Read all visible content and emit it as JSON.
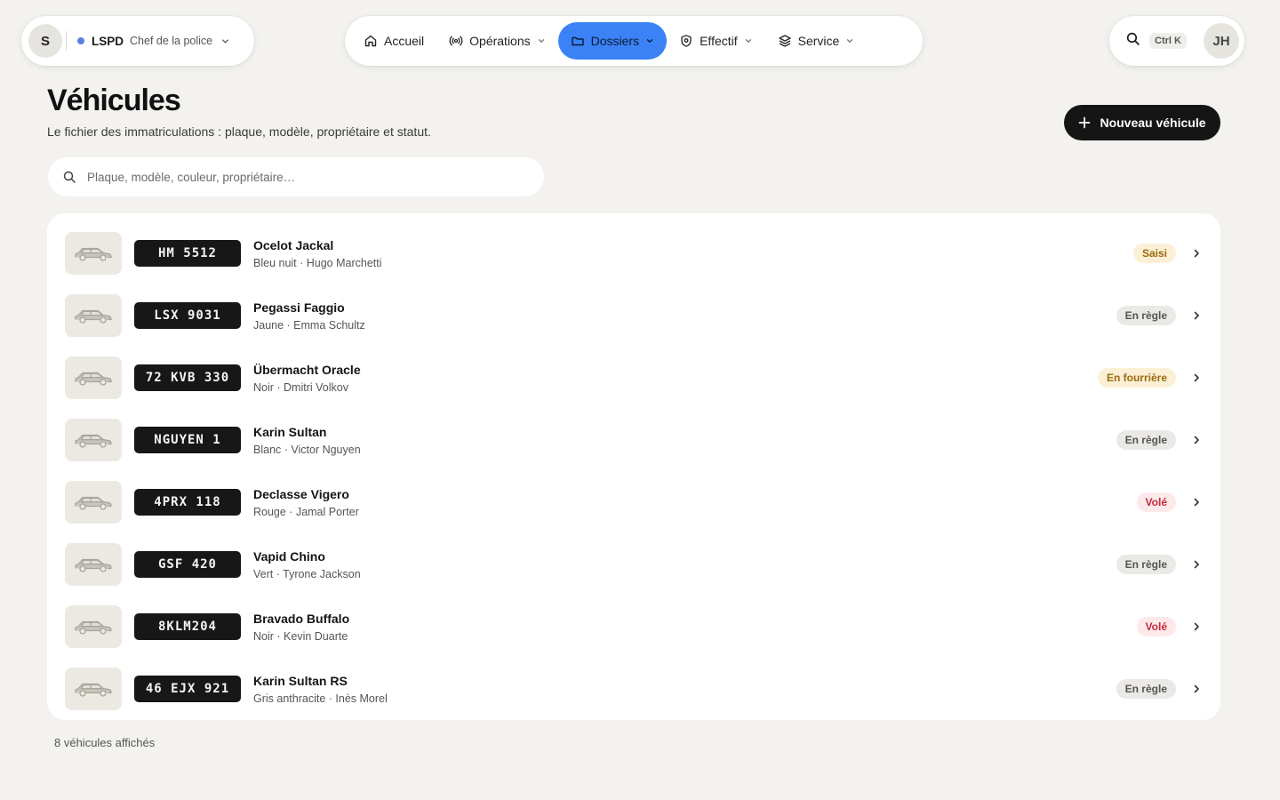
{
  "topbar": {
    "org": {
      "avatar_initial": "S",
      "name": "LSPD",
      "role": "Chef de la police",
      "status_color": "#5b7fe0"
    },
    "nav": [
      {
        "label": "Accueil",
        "icon": "home-icon",
        "has_dropdown": false,
        "active": false
      },
      {
        "label": "Opérations",
        "icon": "broadcast-icon",
        "has_dropdown": true,
        "active": false
      },
      {
        "label": "Dossiers",
        "icon": "folder-icon",
        "has_dropdown": true,
        "active": true
      },
      {
        "label": "Effectif",
        "icon": "shield-icon",
        "has_dropdown": true,
        "active": false
      },
      {
        "label": "Service",
        "icon": "layers-icon",
        "has_dropdown": true,
        "active": false
      }
    ],
    "shortcut": "Ctrl K",
    "user_initials": "JH",
    "accent": "#3b82f6"
  },
  "header": {
    "title": "Véhicules",
    "subtitle": "Le fichier des immatriculations : plaque, modèle, propriétaire et statut.",
    "new_button_label": "Nouveau véhicule"
  },
  "search": {
    "placeholder": "Plaque, modèle, couleur, propriétaire…",
    "value": ""
  },
  "vehicles": [
    {
      "plate": "HM 5512",
      "model": "Ocelot Jackal",
      "meta": "Bleu nuit · Hugo Marchetti",
      "status": "Saisi",
      "status_kind": "saisi"
    },
    {
      "plate": "LSX 9031",
      "model": "Pegassi Faggio",
      "meta": "Jaune · Emma Schultz",
      "status": "En règle",
      "status_kind": "ok"
    },
    {
      "plate": "72 KVB 330",
      "model": "Übermacht Oracle",
      "meta": "Noir · Dmitri Volkov",
      "status": "En fourrière",
      "status_kind": "fourriere"
    },
    {
      "plate": "NGUYEN 1",
      "model": "Karin Sultan",
      "meta": "Blanc · Victor Nguyen",
      "status": "En règle",
      "status_kind": "ok"
    },
    {
      "plate": "4PRX 118",
      "model": "Declasse Vigero",
      "meta": "Rouge · Jamal Porter",
      "status": "Volé",
      "status_kind": "vole"
    },
    {
      "plate": "GSF 420",
      "model": "Vapid Chino",
      "meta": "Vert · Tyrone Jackson",
      "status": "En règle",
      "status_kind": "ok"
    },
    {
      "plate": "8KLM204",
      "model": "Bravado Buffalo",
      "meta": "Noir · Kevin Duarte",
      "status": "Volé",
      "status_kind": "vole"
    },
    {
      "plate": "46 EJX 921",
      "model": "Karin Sultan RS",
      "meta": "Gris anthracite · Inès Morel",
      "status": "En règle",
      "status_kind": "ok"
    }
  ],
  "footer": {
    "count_label": "8 véhicules affichés"
  }
}
